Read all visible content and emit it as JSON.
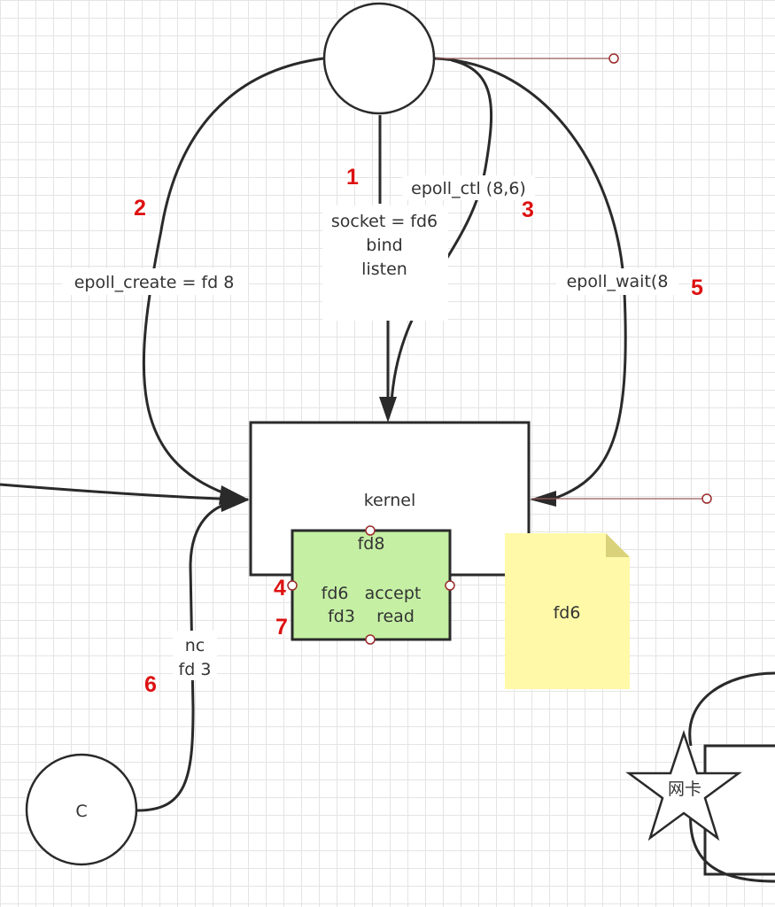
{
  "nodes": {
    "kernel": "kernel",
    "epoll_fd": "fd8",
    "ready_line_1": "fd6   accept",
    "ready_line_2": "fd3    read",
    "note": "fd6",
    "client": "C",
    "nic": "网卡"
  },
  "edges": {
    "socket": [
      "socket = fd6",
      "bind",
      "listen"
    ],
    "epoll_create": "epoll_create = fd 8",
    "epoll_ctl": "epoll_ctl (8,6)",
    "epoll_wait": "epoll_wait(8",
    "nc": [
      "nc",
      "fd 3"
    ]
  },
  "steps": {
    "s1": "1",
    "s2": "2",
    "s3": "3",
    "s4": "4",
    "s5": "5",
    "s6": "6",
    "s7": "7"
  },
  "colors": {
    "ready_list_fill": "#c5f0a4",
    "note_fill": "#fff9a8",
    "note_fold": "#d9d27a",
    "step_number": "#dd1111",
    "line": "#2a2a2a"
  }
}
